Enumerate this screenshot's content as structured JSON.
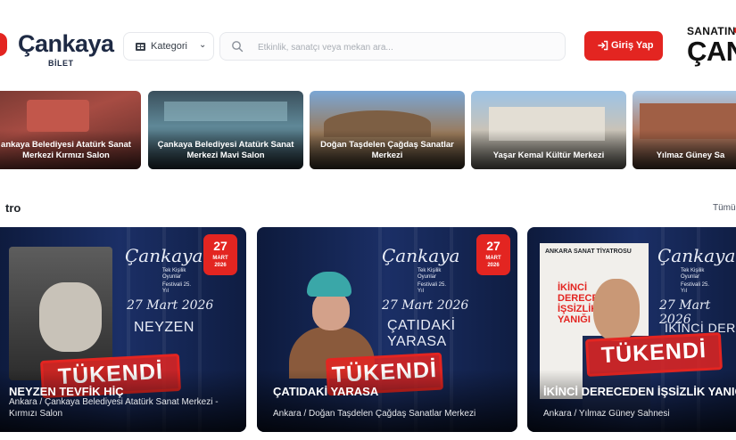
{
  "header": {
    "logo_text": "Çankaya",
    "logo_sub": "BİLET",
    "category_label": "Kategori",
    "search_placeholder": "Etkinlik, sanatçı veya mekan ara...",
    "login_label": "Giriş Yap",
    "brand_top": "SANATIN",
    "brand_big": "ÇANK"
  },
  "venues": [
    {
      "name": "ankaya Belediyesi Atatürk Sanat Merkezi Kırmızı Salon"
    },
    {
      "name": "Çankaya Belediyesi Atatürk Sanat Merkezi Mavi Salon"
    },
    {
      "name": "Doğan Taşdelen Çağdaş Sanatlar Merkezi"
    },
    {
      "name": "Yaşar Kemal Kültür Merkezi"
    },
    {
      "name": "Yılmaz Güney Sa"
    }
  ],
  "section": {
    "title": "tro",
    "see_all": "Tümü"
  },
  "poster_text": {
    "brand_script": "Çankaya",
    "tag_lines": "Tek Kişilik Oyunlar",
    "festival": "Festivali 25. Yıl",
    "date_script": "27 Mart 2026",
    "card3_theatre": "ANKARA SANAT TİYATROSU",
    "card3_title": "İKİNCİ DERECEDEN İŞSİZLİK YANIĞI",
    "card3_script_title": "İKİNCİ DERE"
  },
  "events": [
    {
      "title": "NEYZEN TEVFİK HİÇ",
      "location": "Ankara / Çankaya Belediyesi Atatürk Sanat Merkezi - Kırmızı Salon",
      "poster_title": "NEYZEN",
      "day": "27",
      "month": "MART",
      "year": "2026",
      "status": "TÜKENDİ"
    },
    {
      "title": "ÇATIDAKİ YARASA",
      "location": "Ankara / Doğan Taşdelen Çağdaş Sanatlar Merkezi",
      "poster_title": "ÇATIDAKİ YARASA",
      "day": "27",
      "month": "MART",
      "year": "2026",
      "status": "TÜKENDİ"
    },
    {
      "title": "İKİNCİ DERECEDEN İŞSİZLİK YANIĞI",
      "location": "Ankara / Yılmaz Güney Sahnesi",
      "status": "TÜKENDİ"
    }
  ],
  "colors": {
    "accent": "#e32521",
    "navy": "#1e2a44",
    "card_bg": "#13224d"
  }
}
